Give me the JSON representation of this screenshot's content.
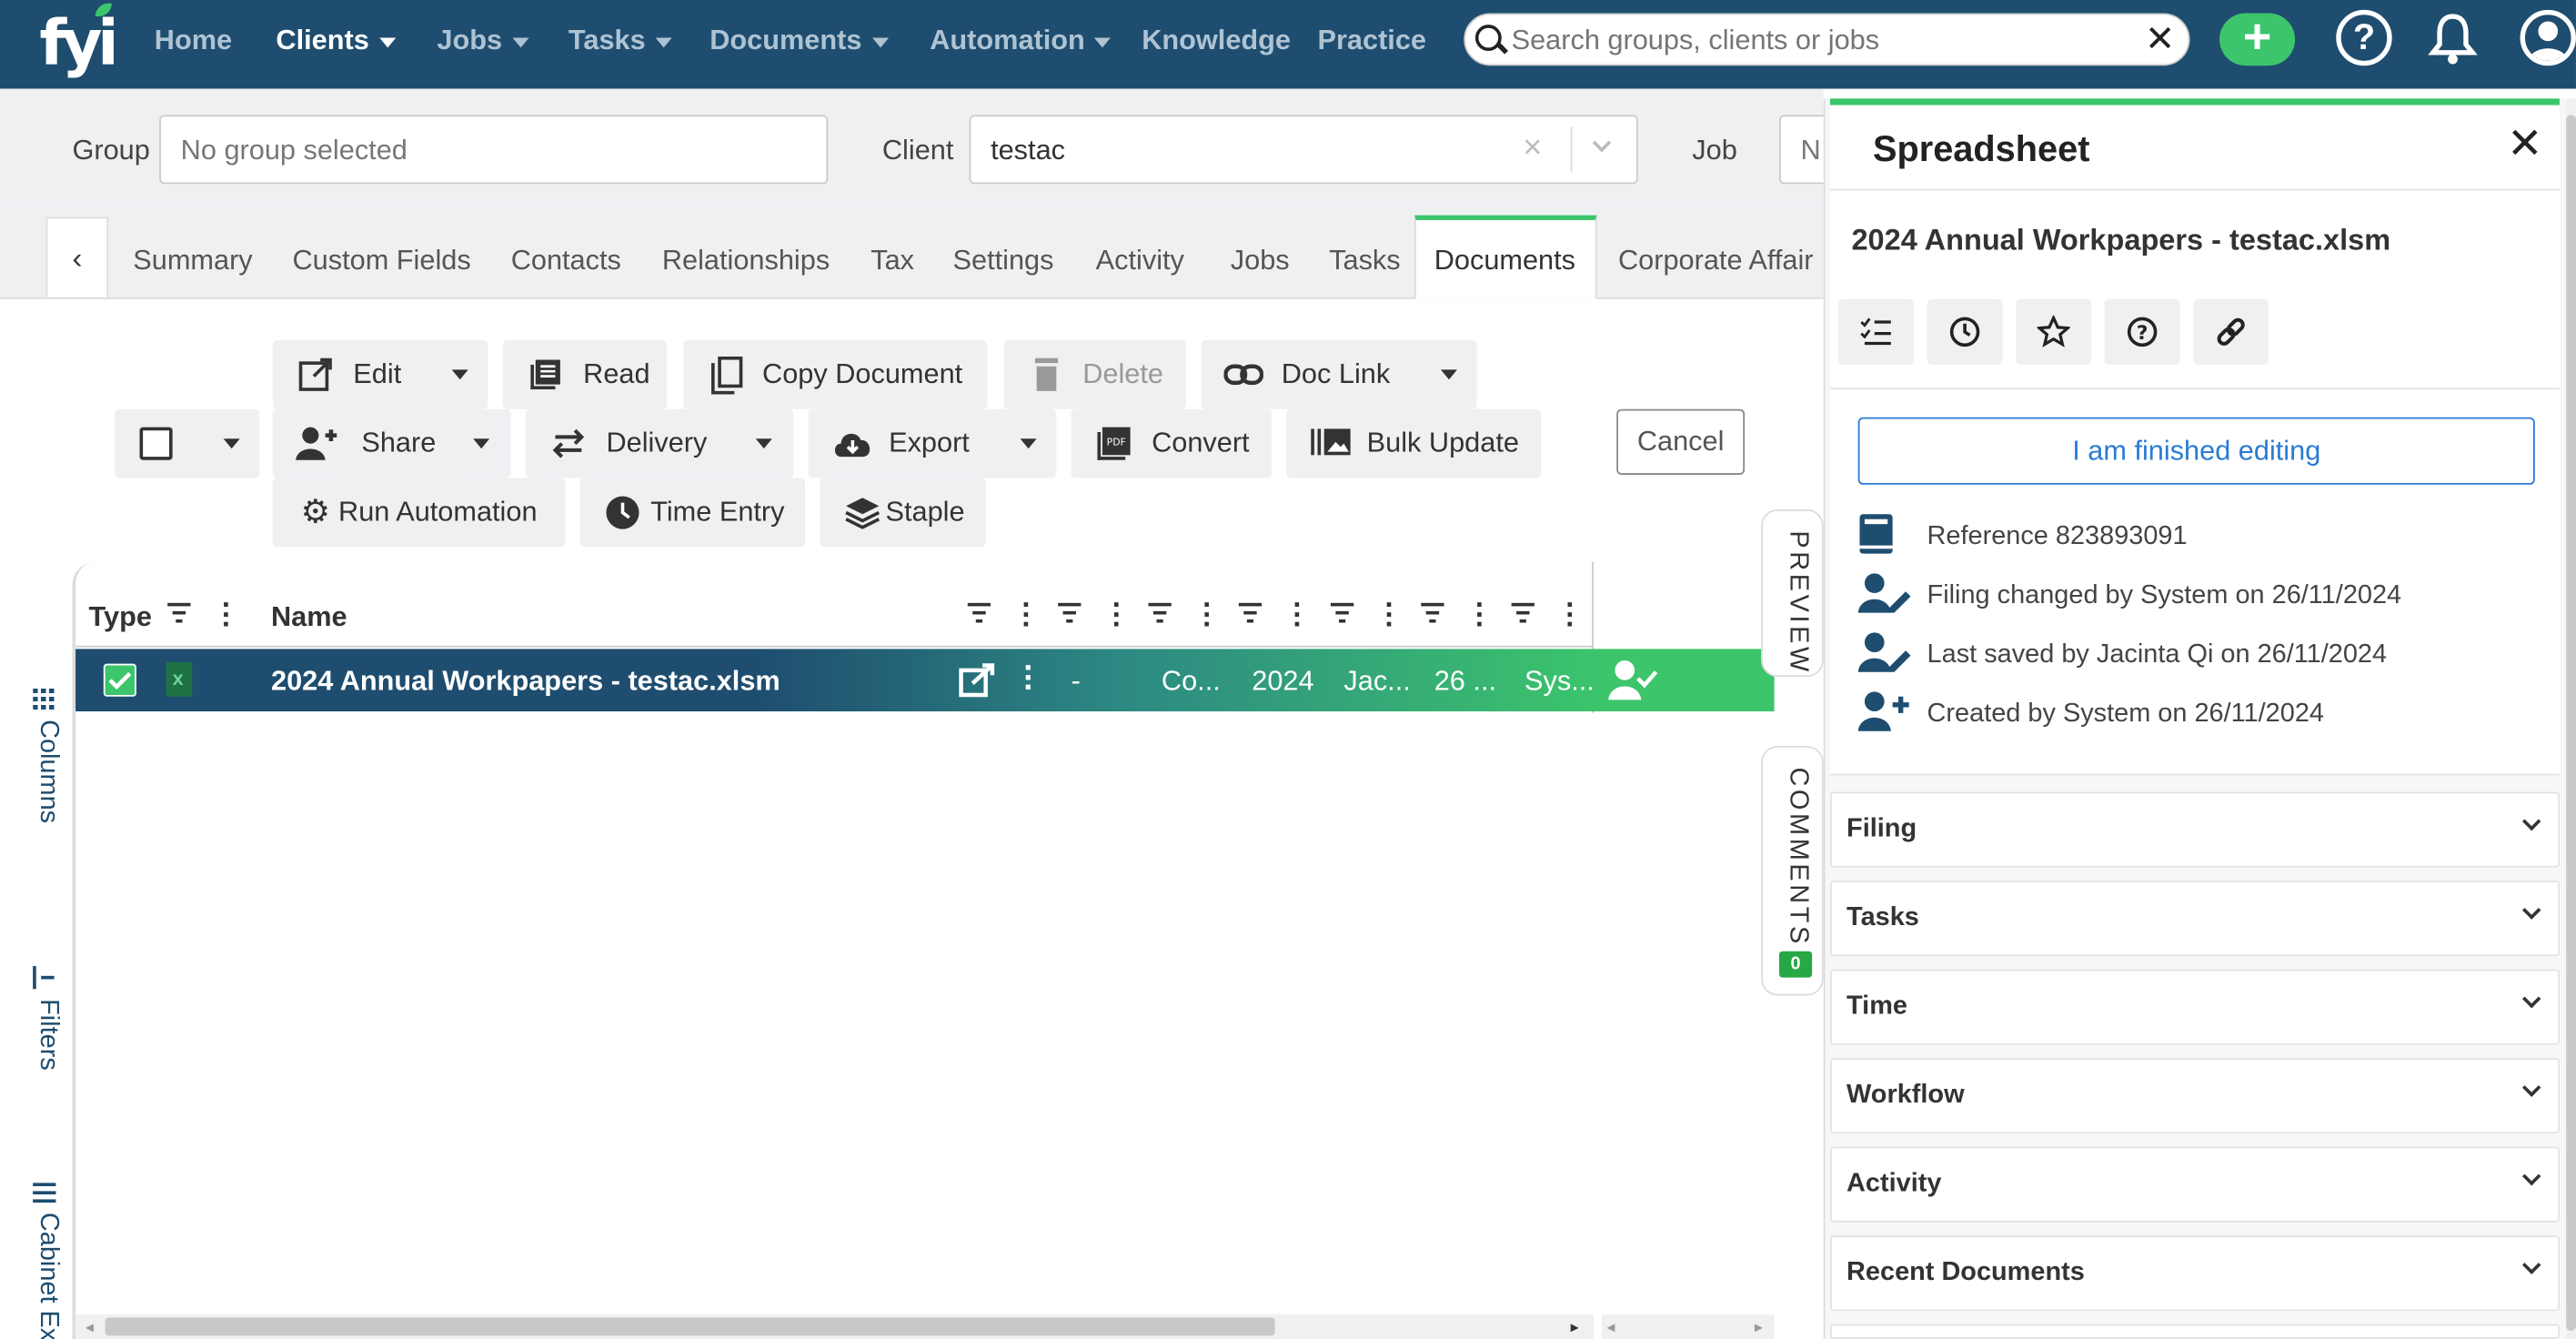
{
  "nav": {
    "logo": "fyi",
    "items": [
      {
        "label": "Home",
        "dropdown": false,
        "active": false
      },
      {
        "label": "Clients",
        "dropdown": true,
        "active": true
      },
      {
        "label": "Jobs",
        "dropdown": true,
        "active": false
      },
      {
        "label": "Tasks",
        "dropdown": true,
        "active": false
      },
      {
        "label": "Documents",
        "dropdown": true,
        "active": false
      },
      {
        "label": "Automation",
        "dropdown": true,
        "active": false
      },
      {
        "label": "Knowledge",
        "dropdown": false,
        "active": false
      },
      {
        "label": "Practice",
        "dropdown": false,
        "active": false
      }
    ],
    "search_placeholder": "Search groups, clients or jobs",
    "clear_glyph": "✕",
    "add_glyph": "+",
    "help_glyph": "?"
  },
  "filters": {
    "group_label": "Group",
    "group_value": "No group selected",
    "client_label": "Client",
    "client_value": "testac",
    "job_label": "Job",
    "job_value": "N"
  },
  "tabs": {
    "prev_glyph": "‹",
    "items": [
      "Summary",
      "Custom Fields",
      "Contacts",
      "Relationships",
      "Tax",
      "Settings",
      "Activity",
      "Jobs",
      "Tasks",
      "Documents",
      "Corporate Affair"
    ],
    "active": "Documents"
  },
  "toolbar": {
    "edit": "Edit",
    "read": "Read",
    "copy": "Copy Document",
    "delete": "Delete",
    "doclink": "Doc Link",
    "share": "Share",
    "delivery": "Delivery",
    "export": "Export",
    "convert": "Convert",
    "bulk_update": "Bulk Update",
    "run_automation": "Run Automation",
    "time_entry": "Time Entry",
    "staple": "Staple",
    "cancel": "Cancel"
  },
  "grid": {
    "col_type": "Type",
    "col_name": "Name",
    "row": {
      "name": "2024 Annual Workpapers - testac.xlsm",
      "cells": [
        "-",
        "Co...",
        "2024",
        "Jac...",
        "26 ...",
        "Sys..."
      ]
    }
  },
  "side_rails": {
    "columns": "Columns",
    "filters": "Filters",
    "cabinet": "Cabinet Ex",
    "preview": "PREVIEW",
    "comments": "COMMENTS",
    "comments_count": "0"
  },
  "panel": {
    "title": "Spreadsheet",
    "close_glyph": "✕",
    "doc_title": "2024 Annual Workpapers - testac.xlsm",
    "finish_button": "I am finished editing",
    "meta": [
      {
        "icon": "book-icon",
        "text": "Reference 823893091"
      },
      {
        "icon": "user-edit-icon",
        "text": "Filing changed by System on 26/11/2024"
      },
      {
        "icon": "user-edit-icon",
        "text": "Last saved by Jacinta Qi on 26/11/2024"
      },
      {
        "icon": "user-plus-icon",
        "text": "Created by System on 26/11/2024"
      }
    ],
    "sections": [
      "Filing",
      "Tasks",
      "Time",
      "Workflow",
      "Activity",
      "Recent Documents"
    ]
  },
  "colors": {
    "nav_bg": "#1e4d6f",
    "accent_green": "#3cc56b",
    "link_blue": "#2a7bd3"
  }
}
